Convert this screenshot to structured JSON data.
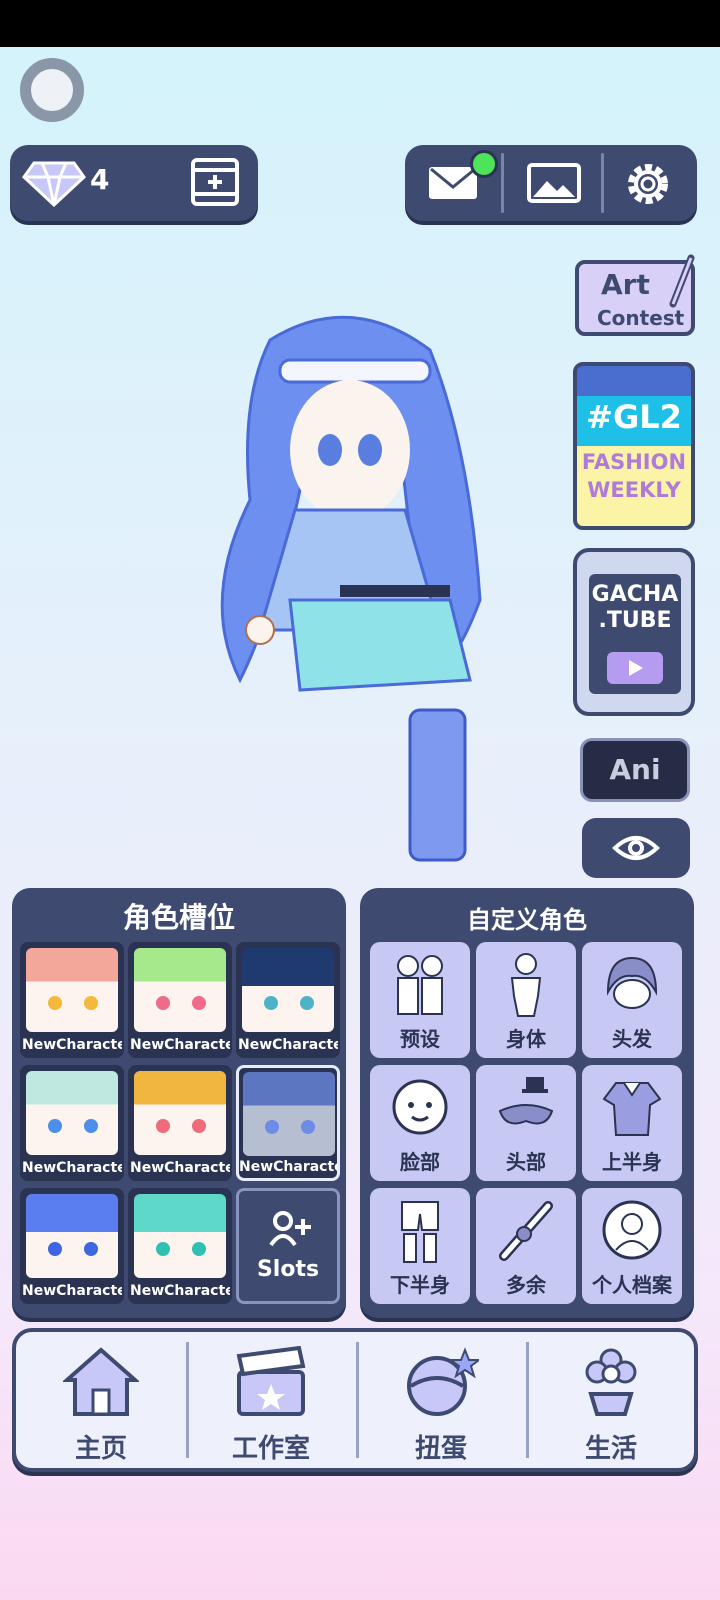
{
  "currency": {
    "gems": "4"
  },
  "side": {
    "art_line1": "Art",
    "art_line2": "Contest",
    "gl2_tag": "#GL2",
    "gl2_line1": "FASHION",
    "gl2_line2": "WEEKLY",
    "tube_line1": "GACHA",
    "tube_line2": ".TUBE",
    "ani_label": "Ani"
  },
  "character_slots": {
    "title": "角色槽位",
    "slots": [
      {
        "name": "NewCharacter",
        "hair": "#f3a79a",
        "eye": "#f6b83a"
      },
      {
        "name": "NewCharacter",
        "hair": "#a6e88c",
        "eye": "#f06a8a"
      },
      {
        "name": "NewCharacter",
        "hair": "#1e3a6e",
        "eye": "#4fb3c8"
      },
      {
        "name": "NewCharacter",
        "hair": "#bfe8e0",
        "eye": "#4c8ee8"
      },
      {
        "name": "NewCharacter",
        "hair": "#f1b640",
        "eye": "#ef6a7a"
      },
      {
        "name": "NewCharacter",
        "hair": "#6d8ce8",
        "eye": "#6d8ce8"
      },
      {
        "name": "NewCharacter",
        "hair": "#5a7ef0",
        "eye": "#3e66e0"
      },
      {
        "name": "NewCharacter",
        "hair": "#5ed8c8",
        "eye": "#2ec0b0"
      }
    ],
    "slots_button": "Slots"
  },
  "customize": {
    "title": "自定义角色",
    "items": [
      {
        "label": "预设",
        "icon": "preset-icon"
      },
      {
        "label": "身体",
        "icon": "body-icon"
      },
      {
        "label": "头发",
        "icon": "hair-icon"
      },
      {
        "label": "脸部",
        "icon": "face-icon"
      },
      {
        "label": "头部",
        "icon": "head-accessory-icon"
      },
      {
        "label": "上半身",
        "icon": "upper-body-icon"
      },
      {
        "label": "下半身",
        "icon": "lower-body-icon"
      },
      {
        "label": "多余",
        "icon": "extra-icon"
      },
      {
        "label": "个人档案",
        "icon": "profile-icon"
      }
    ]
  },
  "nav": {
    "items": [
      {
        "label": "主页",
        "icon": "home-icon"
      },
      {
        "label": "工作室",
        "icon": "studio-icon"
      },
      {
        "label": "扭蛋",
        "icon": "gacha-icon"
      },
      {
        "label": "生活",
        "icon": "life-icon"
      }
    ]
  },
  "colors": {
    "panel": "#3e4a70",
    "tile": "#c8c8f4",
    "notification": "#4fe35a"
  }
}
